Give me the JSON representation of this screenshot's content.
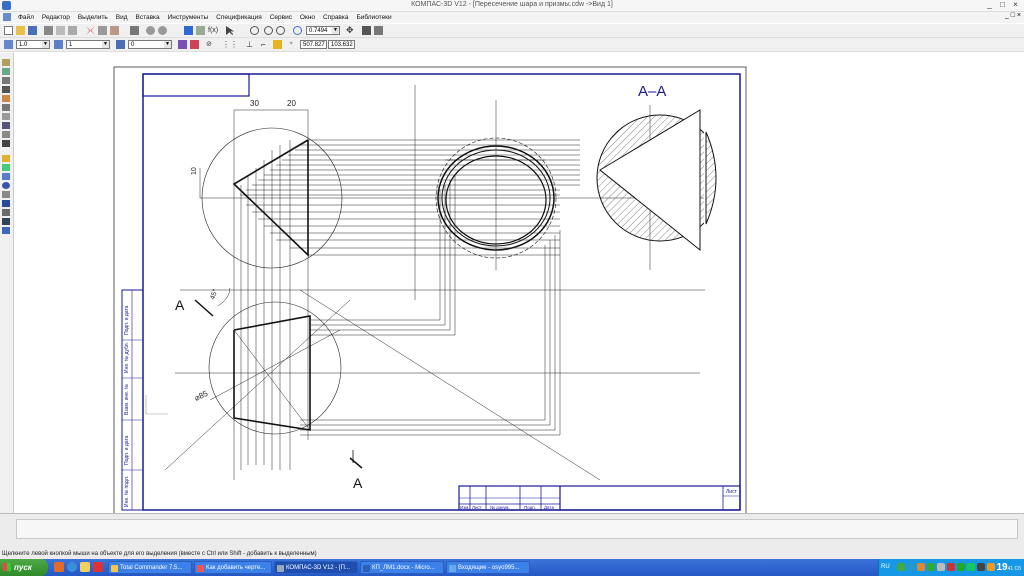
{
  "window": {
    "title": "КОМПАС-3D V12 - [Пересечение шара и призмы.cdw ->Вид 1]",
    "controls": [
      "_",
      "□",
      "×"
    ]
  },
  "menu": [
    "Файл",
    "Редактор",
    "Выделить",
    "Вид",
    "Вставка",
    "Инструменты",
    "Спецификация",
    "Сервис",
    "Окно",
    "Справка",
    "Библиотеки"
  ],
  "mdi_controls": [
    "_",
    "□",
    "×"
  ],
  "toolbar1": {
    "zoom_value": "0.7494"
  },
  "toolbar2": {
    "line_scale": "1.0",
    "layer": "1",
    "style": "0",
    "coord_x": "507.827",
    "coord_y": "103.632"
  },
  "drawing": {
    "section_label": "A–A",
    "dim_30": "30",
    "dim_20": "20",
    "dim_10": "10",
    "angle_label": "45°",
    "diameter_label": "⌀85",
    "cut_label_1": "A",
    "cut_label_2": "A",
    "side_stamp": [
      "Подп. и дата",
      "Инв. № дубл.",
      "Взам. инв. №",
      "Подп. и дата",
      "Инв. № подл."
    ],
    "title_block": {
      "headers": [
        "Изм.",
        "Лист",
        "№ докум.",
        "Подп.",
        "Дата"
      ],
      "sheet_label": "Лист"
    }
  },
  "status_line": "Щелкните левой кнопкой мыши на объекте для его выделения (вместе с Ctrl или Shift - добавить к выделенным)",
  "taskbar": {
    "start": "пуск",
    "tasks": [
      {
        "label": "Total Commander 7.5...",
        "active": false
      },
      {
        "label": "Как добавить черте...",
        "active": false
      },
      {
        "label": "КОМПАС-3D V12 - [П...",
        "active": true
      },
      {
        "label": "КП_ЛМ1.docx - Micro...",
        "active": false
      },
      {
        "label": "Входящие - osyo995...",
        "active": false
      }
    ],
    "lang": "RU",
    "time": "19",
    "time_minutes": "41",
    "time_day": "Сб"
  }
}
